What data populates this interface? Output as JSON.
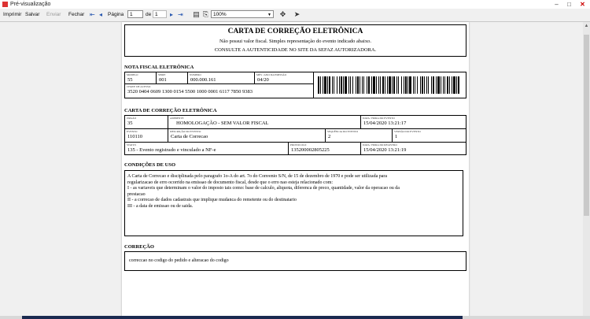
{
  "window": {
    "title": "Pré-visualização",
    "controls": [
      "–",
      "□",
      "✕"
    ]
  },
  "toolbar": {
    "print": "Imprimir",
    "save": "Salvar",
    "send": "Enviar",
    "close": "Fechar",
    "page_label": "Página",
    "page_current": "1",
    "page_of": "de",
    "page_total": "1",
    "zoom": "100%",
    "icons": [
      "first-page-icon",
      "prev-page-icon",
      "next-page-icon",
      "last-page-icon",
      "page-setup-icon",
      "export-icon",
      "zoom-tool-icon",
      "pointer-icon"
    ]
  },
  "document": {
    "header": {
      "title": "CARTA DE CORREÇÃO ELETRÔNICA",
      "line1": "Não possui valor fiscal. Simples representação do evento indicado abaixo.",
      "line2": "CONSULTE A AUTENTICIDADE NO SITE DA SEFAZ AUTORIZADORA."
    },
    "nfe_section": {
      "title": "NOTA FISCAL ELETRÔNICA",
      "fields": [
        {
          "label": "MODELO",
          "value": "55"
        },
        {
          "label": "SÉRIE",
          "value": "001"
        },
        {
          "label": "NÚMERO",
          "value": "000.000.161"
        },
        {
          "label": "MÊS / ANO DA EMISSÃO",
          "value": "04/20"
        }
      ],
      "access_key": {
        "label": "CHAVE DE ACESSO",
        "value": "3520 0404 0609 1300 0154 5500 1000 0001 6117 7850 9383"
      }
    },
    "cce_section": {
      "title": "CARTA DE CORREÇÃO ELETRÔNICA",
      "row1": [
        {
          "label": "ÓRGÃO",
          "value": "35"
        },
        {
          "label": "AMBIENTE",
          "value": "HOMOLOGAÇÃO - SEM VALOR FISCAL"
        },
        {
          "label": "DATA / HORA DO EVENTO",
          "value": "15/04/2020 13:21:17"
        }
      ],
      "row2": [
        {
          "label": "EVENTO",
          "value": "110110"
        },
        {
          "label": "DESCRIÇÃO DO EVENTO",
          "value": "Carta de Correcao"
        },
        {
          "label": "SEQUÊNCIA DO EVENTO",
          "value": "2"
        },
        {
          "label": "VERSÃO DO EVENTO",
          "value": "1"
        }
      ],
      "row3": [
        {
          "label": "STATUS",
          "value": "135 - Evento registrado e vinculado a NF-e"
        },
        {
          "label": "PROTOCOLO",
          "value": "135200002805225"
        },
        {
          "label": "DATA / HORA DO REGISTRO",
          "value": "15/04/2020 13:21:19"
        }
      ]
    },
    "conditions": {
      "title": "CONDIÇÕES DE USO",
      "lines": [
        "A Carta de Correcao e disciplinada pelo paragrafo 1o-A do art. 7o do Convenio S/N, de 15 de dezembro de 1970 e pode ser utilizada para",
        "regularizacao de erro ocorrido na emissao de documento fiscal, desde que o erro nao esteja relacionado com:",
        "I - as variaveis que determinam o valor do imposto tais como: base de calculo, aliquota, diferenca de preco, quantidade, valor da operacao ou da",
        "prestacao",
        "II - a correcao de dados cadastrais que implique mudanca do remetente ou do destinatario",
        "III - a data de emissao ou de saida."
      ]
    },
    "correction": {
      "title": "CORREÇÃO",
      "text": "correccao no codigo do pedido e alteracao do codigo"
    }
  }
}
